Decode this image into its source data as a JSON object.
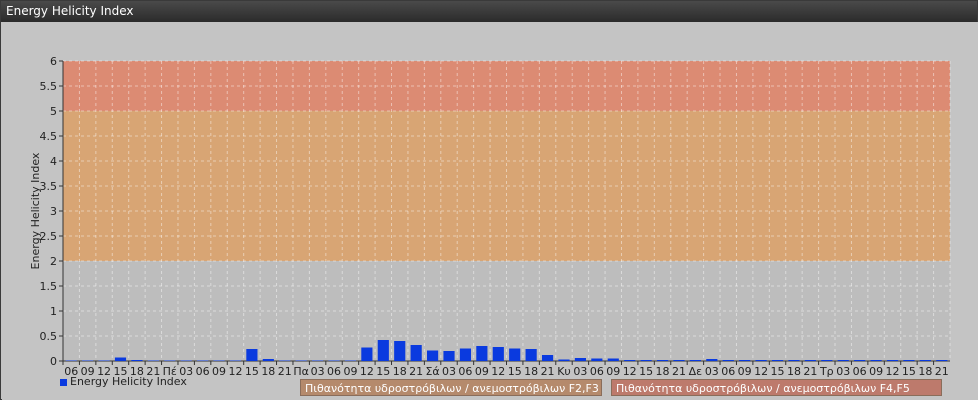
{
  "window": {
    "title": "Energy Helicity Index"
  },
  "legend": {
    "series_label": "Energy Helicity Index",
    "band_f2f3": "Πιθανότητα υδροστρόβιλων / ανεμοστρόβιλων F2,F3",
    "band_f4f5": "Πιθανότητα υδροστρόβιλων / ανεμοστρόβιλων F4,F5"
  },
  "colors": {
    "bar": "#0a3adf",
    "band_low": "#bdbdbd",
    "band_f2f3": "#d8a574",
    "band_f4f5": "#dc8b73",
    "legend_f2f3": "#b58a6c",
    "legend_f4f5": "#bd7a6c"
  },
  "chart_data": {
    "type": "bar",
    "title": "",
    "ylabel": "Energy Helicity Index",
    "xlabel": "",
    "ylim": [
      0,
      6
    ],
    "yticks": [
      "0",
      "0.5",
      "1",
      "1.5",
      "2",
      "2.5",
      "3",
      "3.5",
      "4",
      "4.5",
      "5",
      "5.5",
      "6"
    ],
    "grid": true,
    "legend_position": "bottom",
    "bands": [
      {
        "from": 0,
        "to": 2,
        "label": ""
      },
      {
        "from": 2,
        "to": 5,
        "label": "Πιθανότητα υδροστρόβιλων / ανεμοστρόβιλων F2,F3"
      },
      {
        "from": 5,
        "to": 6,
        "label": "Πιθανότητα υδροστρόβιλων / ανεμοστρόβιλων F4,F5"
      }
    ],
    "categories": [
      "06",
      "09",
      "12",
      "15",
      "18",
      "21",
      "Πέ",
      "03",
      "06",
      "09",
      "12",
      "15",
      "18",
      "21",
      "Πα",
      "03",
      "06",
      "09",
      "12",
      "15",
      "18",
      "21",
      "Σά",
      "03",
      "06",
      "09",
      "12",
      "15",
      "18",
      "21",
      "Κυ",
      "03",
      "06",
      "09",
      "12",
      "15",
      "18",
      "21",
      "Δε",
      "03",
      "06",
      "09",
      "12",
      "15",
      "18",
      "21",
      "Τρ",
      "03",
      "06",
      "09",
      "12",
      "15",
      "18",
      "21"
    ],
    "series": [
      {
        "name": "Energy Helicity Index",
        "values": [
          0.01,
          0.01,
          0.01,
          0.07,
          0.02,
          0.01,
          0.01,
          0.01,
          0.01,
          0.01,
          0.01,
          0.24,
          0.04,
          0.01,
          0.01,
          0.01,
          0.01,
          0.01,
          0.27,
          0.42,
          0.4,
          0.32,
          0.21,
          0.2,
          0.25,
          0.3,
          0.28,
          0.25,
          0.24,
          0.12,
          0.03,
          0.06,
          0.05,
          0.05,
          0.02,
          0.02,
          0.02,
          0.02,
          0.02,
          0.04,
          0.02,
          0.02,
          0.02,
          0.02,
          0.02,
          0.02,
          0.02,
          0.02,
          0.02,
          0.02,
          0.02,
          0.02,
          0.02,
          0.02
        ]
      }
    ]
  }
}
